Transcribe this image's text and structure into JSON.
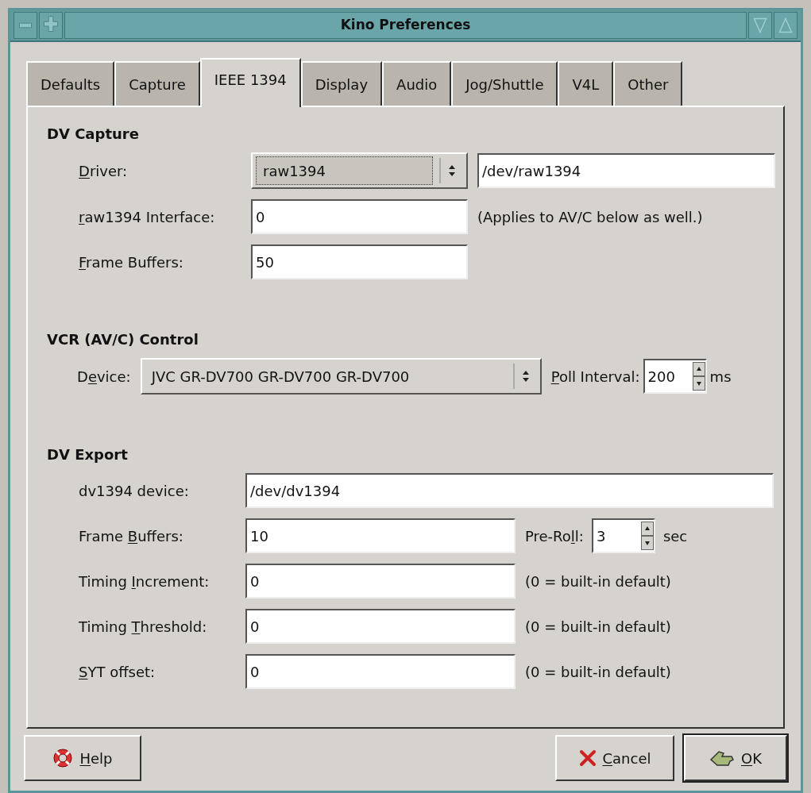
{
  "window": {
    "title": "Kino Preferences"
  },
  "tabs": [
    {
      "label": "Defaults",
      "selected": false
    },
    {
      "label": "Capture",
      "selected": false
    },
    {
      "label": "IEEE 1394",
      "selected": true
    },
    {
      "label": "Display",
      "selected": false
    },
    {
      "label": "Audio",
      "selected": false
    },
    {
      "label": "Jog/Shuttle",
      "selected": false
    },
    {
      "label": "V4L",
      "selected": false
    },
    {
      "label": "Other",
      "selected": false
    }
  ],
  "sections": [
    {
      "heading": "DV Capture",
      "rows": [
        [
          {
            "kind": "label",
            "parts": [
              {
                "text": "D",
                "underline": true
              },
              {
                "text": "river:",
                "underline": false
              }
            ]
          },
          {
            "kind": "combo",
            "value": "raw1394",
            "focused": true
          },
          {
            "kind": "entry",
            "value": "/dev/raw1394"
          }
        ],
        [
          {
            "kind": "label",
            "parts": [
              {
                "text": "r",
                "underline": true
              },
              {
                "text": "aw1394 Interface:",
                "underline": false
              }
            ]
          },
          {
            "kind": "entry",
            "value": "0"
          },
          {
            "kind": "note",
            "text": "(Applies to AV/C below as well.)"
          }
        ],
        [
          {
            "kind": "label",
            "parts": [
              {
                "text": "F",
                "underline": true
              },
              {
                "text": "rame Buffers:",
                "underline": false
              }
            ]
          },
          {
            "kind": "entry",
            "value": "50"
          }
        ]
      ]
    },
    {
      "heading": "VCR (AV/C) Control",
      "rows": [
        [
          {
            "kind": "label",
            "parts": [
              {
                "text": "D",
                "underline": false
              },
              {
                "text": "e",
                "underline": true
              },
              {
                "text": "vice:",
                "underline": false
              }
            ]
          },
          {
            "kind": "combo",
            "value": "JVC GR-DV700 GR-DV700 GR-DV700",
            "focused": false
          },
          {
            "kind": "label",
            "parts": [
              {
                "text": "P",
                "underline": true
              },
              {
                "text": "oll Interval:",
                "underline": false
              }
            ]
          },
          {
            "kind": "spin",
            "value": "200"
          },
          {
            "kind": "note",
            "text": "ms"
          }
        ]
      ]
    },
    {
      "heading": "DV Export",
      "rows": [
        [
          {
            "kind": "label",
            "parts": [
              {
                "text": "dv1394 device:",
                "underline": false
              }
            ]
          },
          {
            "kind": "entry",
            "value": "/dev/dv1394"
          }
        ],
        [
          {
            "kind": "label",
            "parts": [
              {
                "text": "Frame ",
                "underline": false
              },
              {
                "text": "B",
                "underline": true
              },
              {
                "text": "uffers:",
                "underline": false
              }
            ]
          },
          {
            "kind": "entry",
            "value": "10"
          },
          {
            "kind": "label",
            "parts": [
              {
                "text": "Pre-Ro",
                "underline": false
              },
              {
                "text": "l",
                "underline": true
              },
              {
                "text": "l:",
                "underline": false
              }
            ]
          },
          {
            "kind": "spin",
            "value": "3"
          },
          {
            "kind": "note",
            "text": "sec"
          }
        ],
        [
          {
            "kind": "label",
            "parts": [
              {
                "text": "Timing ",
                "underline": false
              },
              {
                "text": "I",
                "underline": true
              },
              {
                "text": "ncrement:",
                "underline": false
              }
            ]
          },
          {
            "kind": "entry",
            "value": "0"
          },
          {
            "kind": "note",
            "text": "(0 = built-in default)"
          }
        ],
        [
          {
            "kind": "label",
            "parts": [
              {
                "text": "Timing ",
                "underline": false
              },
              {
                "text": "T",
                "underline": true
              },
              {
                "text": "hreshold:",
                "underline": false
              }
            ]
          },
          {
            "kind": "entry",
            "value": "0"
          },
          {
            "kind": "note",
            "text": "(0 = built-in default)"
          }
        ],
        [
          {
            "kind": "label",
            "parts": [
              {
                "text": "S",
                "underline": true
              },
              {
                "text": "YT offset:",
                "underline": false
              }
            ]
          },
          {
            "kind": "entry",
            "value": "0"
          },
          {
            "kind": "note",
            "text": "(0 = built-in default)"
          }
        ]
      ]
    }
  ],
  "buttons": [
    {
      "kind": "help",
      "default": false,
      "parts": [
        {
          "text": "H",
          "underline": true
        },
        {
          "text": "elp",
          "underline": false
        }
      ]
    },
    {
      "kind": "cancel",
      "default": false,
      "parts": [
        {
          "text": "C",
          "underline": true
        },
        {
          "text": "ancel",
          "underline": false
        }
      ]
    },
    {
      "kind": "ok",
      "default": true,
      "parts": [
        {
          "text": "O",
          "underline": true
        },
        {
          "text": "K",
          "underline": false
        }
      ]
    }
  ]
}
